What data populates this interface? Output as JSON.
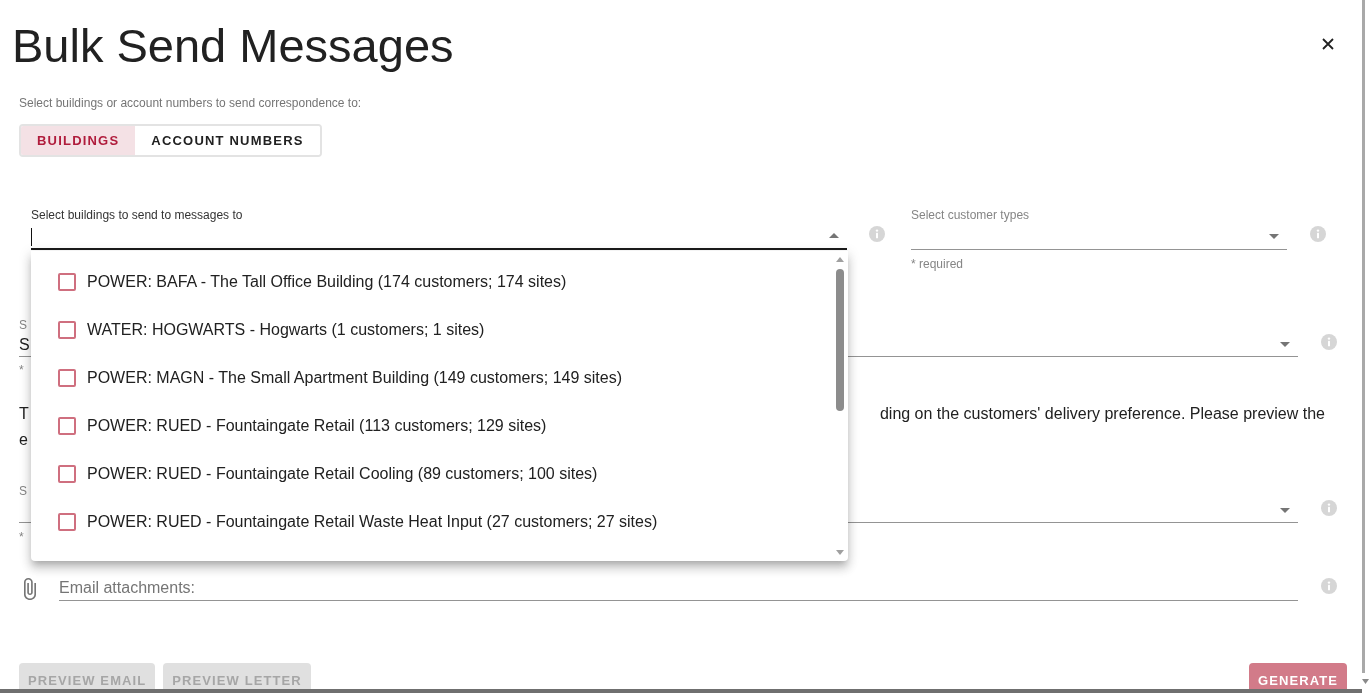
{
  "title": "Bulk Send Messages",
  "recipient_prompt": "Select buildings or account numbers to send correspondence to:",
  "recipient_toggle": [
    {
      "label": "BUILDINGS",
      "selected": true
    },
    {
      "label": "ACCOUNT NUMBERS",
      "selected": false
    }
  ],
  "top_selects": [
    {
      "label": "Select buildings to send to messages to",
      "focused": true,
      "expanded": true,
      "options": [
        {
          "label": "POWER: BAFA - The Tall Office Building (174 customers; 174 sites)",
          "checked": false
        },
        {
          "label": "WATER: HOGWARTS - Hogwarts (1 customers; 1 sites)",
          "checked": false
        },
        {
          "label": "POWER: MAGN - The Small Apartment Building (149 customers; 149 sites)",
          "checked": false
        },
        {
          "label": "POWER: RUED - Fountaingate Retail (113 customers; 129 sites)",
          "checked": false
        },
        {
          "label": "POWER: RUED - Fountaingate Retail Cooling (89 customers; 100 sites)",
          "checked": false
        },
        {
          "label": "POWER: RUED - Fountaingate Retail Waste Heat Input (27 customers; 27 sites)",
          "checked": false
        }
      ]
    },
    {
      "label": "Select customer types",
      "focused": false,
      "expanded": false,
      "hint": "* required"
    }
  ],
  "select_2": {
    "label": "S",
    "value": "S",
    "hint": "*"
  },
  "notice": {
    "line_1_start": "T",
    "line_1_end": "ding on the customers' delivery preference. Please preview the",
    "line_2_start": "e"
  },
  "select_3": {
    "label": "S",
    "hint": "*"
  },
  "attachments": {
    "placeholder": "Email attachments:"
  },
  "buttons": [
    {
      "label": "PREVIEW EMAIL",
      "kind": "secondary",
      "disabled": true
    },
    {
      "label": "PREVIEW LETTER",
      "kind": "secondary",
      "disabled": true
    },
    {
      "label": "GENERATE",
      "kind": "primary",
      "disabled": true
    }
  ]
}
